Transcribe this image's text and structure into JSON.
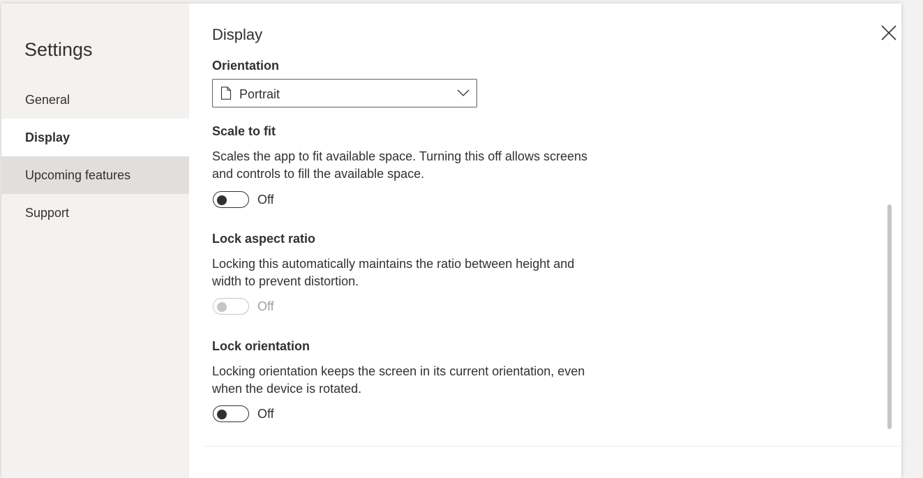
{
  "settings": {
    "title": "Settings",
    "nav": [
      {
        "label": "General",
        "state": "normal"
      },
      {
        "label": "Display",
        "state": "selected"
      },
      {
        "label": "Upcoming features",
        "state": "hovered"
      },
      {
        "label": "Support",
        "state": "normal"
      }
    ]
  },
  "display": {
    "title": "Display",
    "orientation": {
      "label": "Orientation",
      "value": "Portrait",
      "icon": "document-icon"
    },
    "scale_to_fit": {
      "label": "Scale to fit",
      "description": "Scales the app to fit available space. Turning this off allows screens and controls to fill the available space.",
      "toggle_state": "Off",
      "enabled": true
    },
    "lock_aspect_ratio": {
      "label": "Lock aspect ratio",
      "description": "Locking this automatically maintains the ratio between height and width to prevent distortion.",
      "toggle_state": "Off",
      "enabled": false
    },
    "lock_orientation": {
      "label": "Lock orientation",
      "description": "Locking orientation keeps the screen in its current orientation, even when the device is rotated.",
      "toggle_state": "Off",
      "enabled": true
    }
  },
  "colors": {
    "nav_background": "#f3f2f1",
    "nav_hover": "#e1dfdd",
    "text": "#323130",
    "disabled": "#c8c6c4"
  }
}
